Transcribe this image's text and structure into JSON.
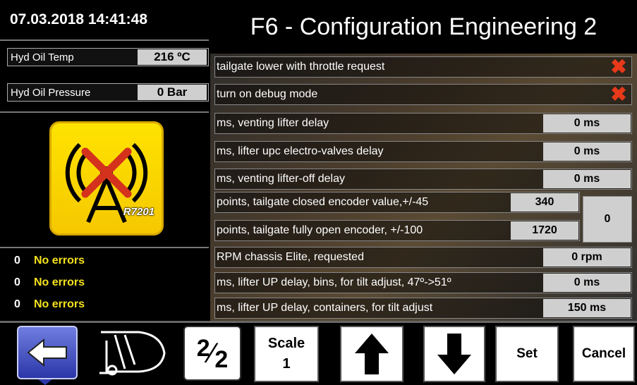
{
  "header": {
    "datetime": "07.03.2018 14:41:48",
    "title": "F6 - Configuration Engineering 2"
  },
  "sensors": [
    {
      "label": "Hyd Oil Temp",
      "value": "216 ºC"
    },
    {
      "label": "Hyd Oil Pressure",
      "value": "0 Bar"
    }
  ],
  "radio": {
    "tag": "R7201",
    "status_icon": "antenna-disconnected-icon"
  },
  "errors": [
    {
      "count": "0",
      "message": "No errors"
    },
    {
      "count": "0",
      "message": "No errors"
    },
    {
      "count": "0",
      "message": "No errors"
    }
  ],
  "config_rows": [
    {
      "label": "tailgate lower with throttle request",
      "value": "",
      "icon": "red-x-icon"
    },
    {
      "label": "turn on debug mode",
      "value": "",
      "icon": "red-x-icon"
    },
    {
      "label": "ms, venting lifter delay",
      "value": "0 ms"
    },
    {
      "label": "ms, lifter upc electro-valves delay",
      "value": "0 ms"
    },
    {
      "label": "ms, venting lifter-off delay",
      "value": "0 ms"
    },
    {
      "label": "points, tailgate closed encoder value,+/-45",
      "value": "340"
    },
    {
      "label": "points, tailgate fully open encoder, +/-100",
      "value": "1720"
    },
    {
      "label": "RPM chassis Elite, requested",
      "value": "0 rpm"
    },
    {
      "label": "ms, lifter UP delay, bins, for tilt adjust, 47º->51º",
      "value": "0 ms"
    },
    {
      "label": "ms, lifter UP delay, containers, for tilt adjust",
      "value": "150 ms"
    }
  ],
  "encoder_current": "0",
  "toolbar": {
    "back_icon": "arrow-left-icon",
    "vehicle_icon": "garbage-truck-icon",
    "page_numerator": "2",
    "page_denominator": "2",
    "scale_label": "Scale",
    "scale_value": "1",
    "up_icon": "arrow-up-icon",
    "down_icon": "arrow-down-icon",
    "set_label": "Set",
    "cancel_label": "Cancel"
  }
}
